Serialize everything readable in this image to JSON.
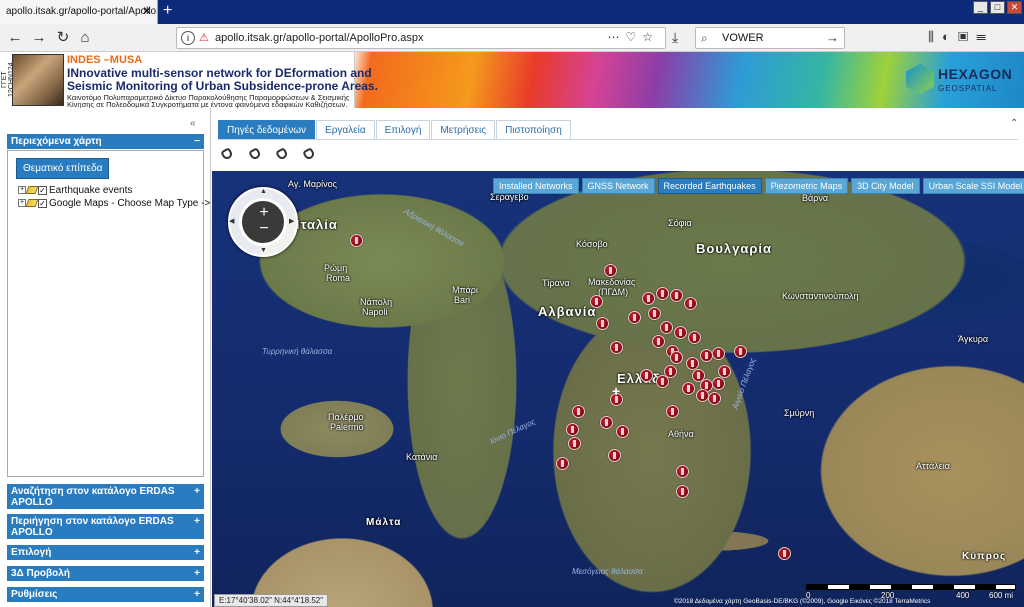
{
  "browser": {
    "tab_title": "apollo.itsak.gr/apollo-portal/ApolloPro",
    "url": "apollo.itsak.gr/apollo-portal/ApolloPro.aspx",
    "search_value": "VOWER"
  },
  "banner": {
    "vertical_label": "ΓΓΕΤ 12CHN124",
    "title": "INDES –MUSA",
    "line1": "INnovative multi-sensor network for DEformation and",
    "line2": "Seismic Monitoring of Urban Subsidence-prone Areas.",
    "sub1": "Καινοτόμο Πολυπαραμετρικό Δίκτυο Παρακολούθησης Παραμορφώσεων & Σεισμικής",
    "sub2": "Κίνησης σε Πολεοδομικά Συγκροτήματα με έντονα φαινόμενα εδαφικών Καθιζήσεων.",
    "logo_name": "HEXAGON",
    "logo_sub": "GEOSPATIAL"
  },
  "left_panel": {
    "contents_title": "Περιεχόμενα χάρτη",
    "theme_button": "Θεματικό επίπεδα",
    "layers": [
      "Earthquake events",
      "Google Maps - Choose Map Type ->"
    ],
    "sections": [
      "Αναζήτηση στον κατάλογο ERDAS APOLLO",
      "Περιήγηση στον κατάλογο ERDAS APOLLO",
      "Επιλογή",
      "3Δ Προβολή",
      "Ρυθμίσεις"
    ]
  },
  "main_tabs": [
    "Πηγές δεδομένων",
    "Εργαλεία",
    "Επιλογή",
    "Μετρήσεις",
    "Πιστοποίηση"
  ],
  "map_layer_buttons": [
    "Installed Networks",
    "GNSS Network",
    "Recorded Earthquakes",
    "Piezometric Maps",
    "3D City Model",
    "Urban Scale SSI Model"
  ],
  "map_labels": {
    "italia": "Ιταλία",
    "greece": "Ελλάδα",
    "albania": "Αλβανία",
    "bulgaria": "Βουλγαρία",
    "fyrom": "Μακεδονίας",
    "fyrom2": "(ΠΓΔΜ)",
    "malta": "Μάλτα",
    "kypros": "Κύπρος",
    "san_marino": "Αγ. Μαρίνος",
    "roma": "Ρώμη",
    "roma2": "Roma",
    "napoli": "Νάπολη",
    "napoli2": "Napoli",
    "bari": "Μπάρι",
    "bari2": "Bari",
    "palermo": "Παλέρμο",
    "palermo2": "Palermo",
    "sofia": "Σόφια",
    "istanbul": "Κωνσταντινούπολη",
    "izmir": "Σμύρνη",
    "athina": "Αθήνα",
    "ankara": "Άγκυρα",
    "sarajevo": "Σεράγεβο",
    "kosovo": "Κόσοβο",
    "varna": "Βάρνα",
    "tirana": "Τίρανα",
    "catania": "Κατάνια",
    "antalya": "Αττάλεια",
    "sea_adriatic": "Αδριατική θάλασσα",
    "sea_ionian": "Ιόνιο Πέλαγος",
    "sea_tyrrhenian": "Τυρρηνική θάλασσα",
    "sea_aegean": "Αιγαίο Πέλαγος",
    "sea_med": "Μεσόγειος θάλασσα"
  },
  "coordinates": "E:17°40'38.02\"  N:44°4'18.52\"",
  "attribution": "©2018 Δεδομένα χάρτη GeoBasis-DE/BKG (©2009), Google Εικόνες ©2018 TerraMetrics",
  "scale": [
    "0",
    "200",
    "400",
    "600 mi"
  ],
  "colors": {
    "accent": "#2a7cc0",
    "quake": "#9b1020",
    "tabbar": "#0c2a7a"
  }
}
